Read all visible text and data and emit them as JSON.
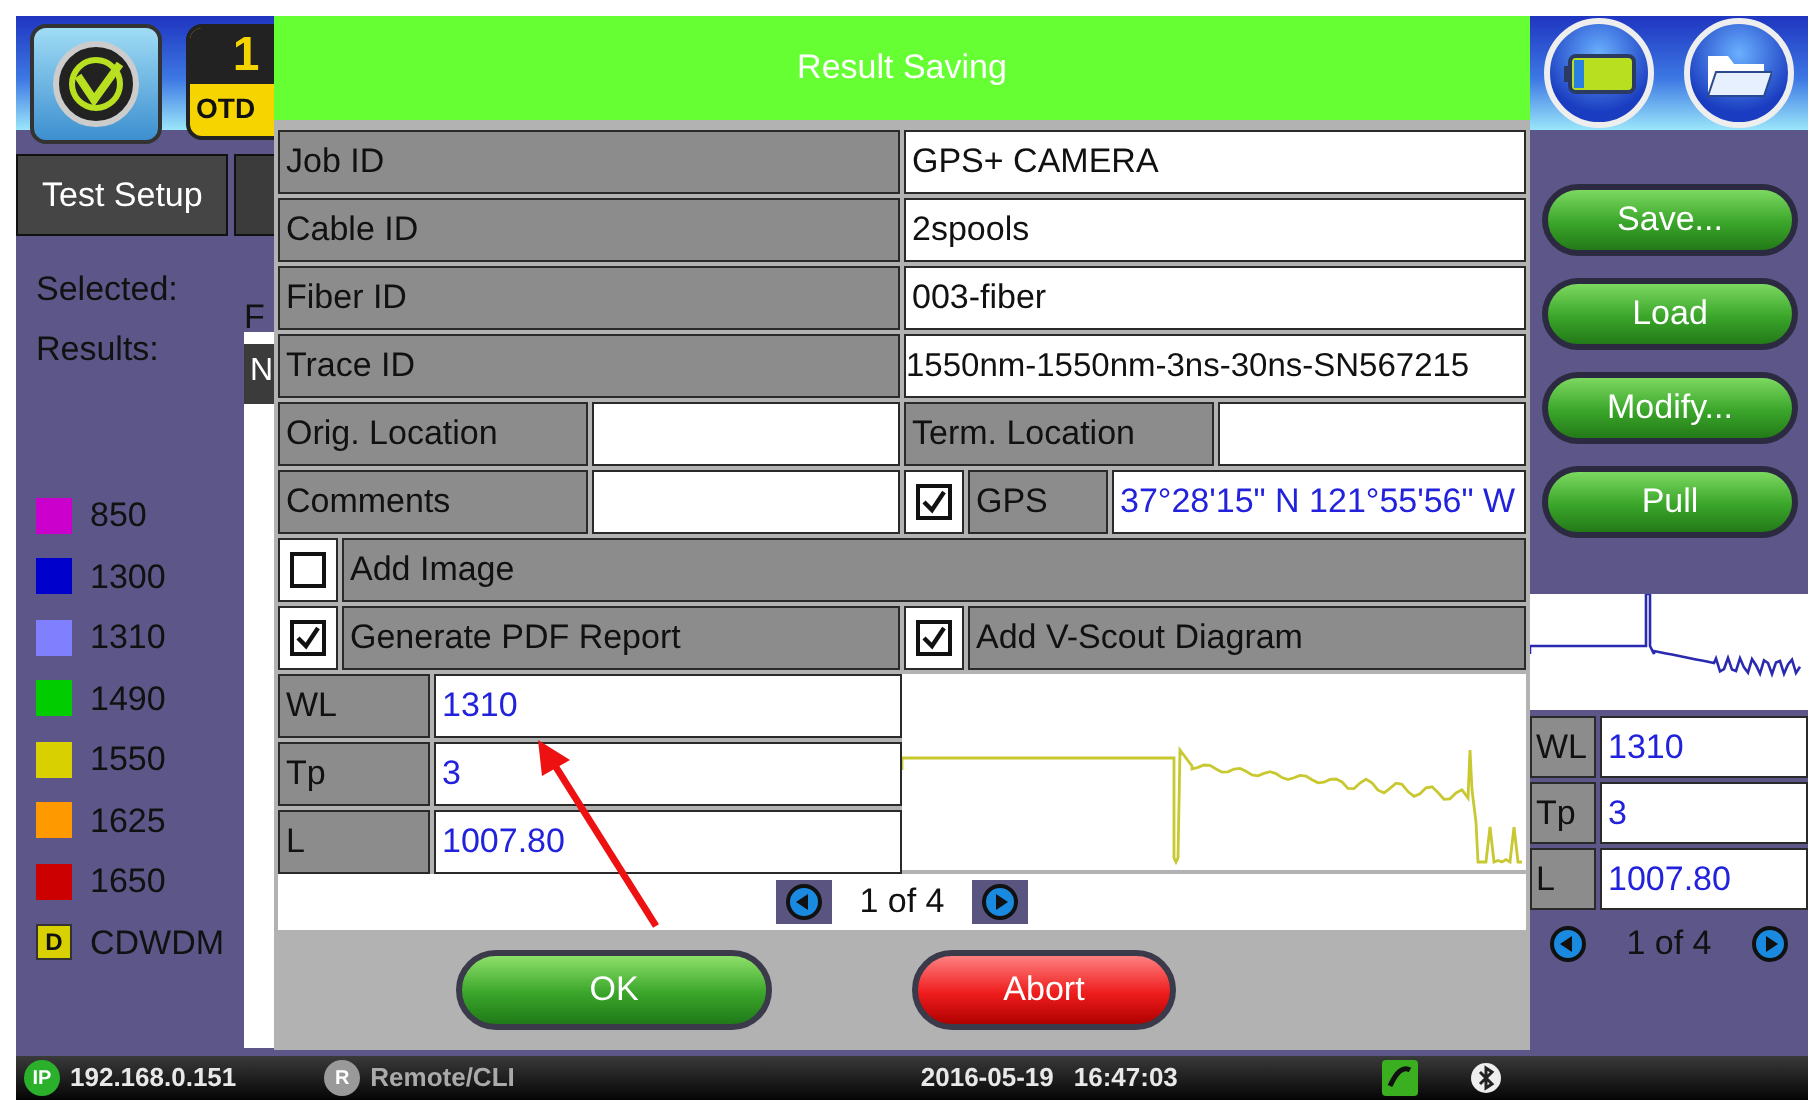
{
  "header": {
    "test_tab": {
      "number": "1",
      "label": "OTD"
    }
  },
  "tab": "Test Setup",
  "left_panel": {
    "selected_label": "Selected:",
    "selected_value": "F",
    "results_label": "Results:",
    "table_header": "N",
    "legend": [
      {
        "kind": "swatch",
        "label": "850",
        "color": "#cc00cc"
      },
      {
        "kind": "swatch",
        "label": "1300",
        "color": "#0000cc"
      },
      {
        "kind": "swatch",
        "label": "1310",
        "color": "#8080ff"
      },
      {
        "kind": "swatch",
        "label": "1490",
        "color": "#00cc00"
      },
      {
        "kind": "swatch",
        "label": "1550",
        "color": "#d8d000"
      },
      {
        "kind": "swatch",
        "label": "1625",
        "color": "#ff9900"
      },
      {
        "kind": "swatch",
        "label": "1650",
        "color": "#cc0000"
      },
      {
        "kind": "badge",
        "badge": "D",
        "label": "CDWDM",
        "color": "#d8d000"
      }
    ]
  },
  "dialog": {
    "title": "Result Saving",
    "id_fields": [
      {
        "label": "Job ID",
        "value": "GPS+ CAMERA"
      },
      {
        "label": "Cable ID",
        "value": "2spools"
      },
      {
        "label": "Fiber ID",
        "value": "003-fiber"
      },
      {
        "label": "Trace ID",
        "value": "1550nm-1550nm-3ns-30ns-SN567215"
      }
    ],
    "locations": [
      {
        "label": "Orig. Location"
      },
      {
        "label": "Term. Location"
      }
    ],
    "comments": {
      "label": "Comments"
    },
    "gps": {
      "checked": true,
      "label": "GPS",
      "value": "37°28'15\" N 121°55'56\" W"
    },
    "option_rows": [
      [
        {
          "label": "Add Image",
          "checked": false
        }
      ],
      [
        {
          "label": "Generate PDF Report",
          "checked": true
        },
        {
          "label": "Add V-Scout Diagram",
          "checked": true
        }
      ]
    ],
    "trace_params": [
      {
        "label": "WL",
        "value": "1310"
      },
      {
        "label": "Tp",
        "value": "3"
      },
      {
        "label": "L",
        "value": "1007.80"
      }
    ],
    "pager": "1 of 4",
    "buttons": [
      {
        "label": "OK",
        "kind": "confirm"
      },
      {
        "label": "Abort",
        "kind": "cancel"
      }
    ]
  },
  "right_panel": {
    "buttons": [
      "Save...",
      "Load",
      "Modify...",
      "Pull"
    ],
    "trace_params": [
      {
        "label": "WL",
        "value": "1310"
      },
      {
        "label": "Tp",
        "value": "3"
      },
      {
        "label": "L",
        "value": "1007.80"
      }
    ],
    "pager": "1 of 4"
  },
  "status_bar": {
    "ip_badge": "IP",
    "ip": "192.168.0.151",
    "remote_badge": "R",
    "remote": "Remote/CLI",
    "date": "2016-05-19",
    "time": "16:47:03"
  }
}
